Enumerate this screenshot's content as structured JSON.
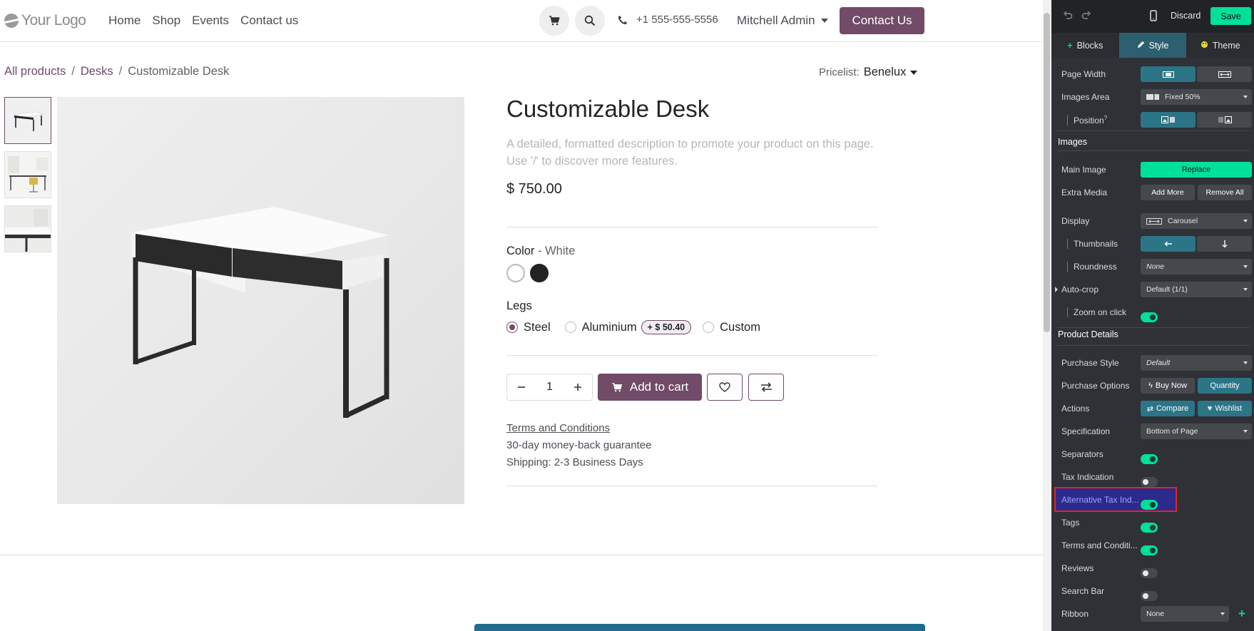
{
  "site": {
    "logo_text": "Your Logo",
    "menu": [
      "Home",
      "Shop",
      "Events",
      "Contact us"
    ],
    "phone": "+1 555-555-5556",
    "user": "Mitchell Admin",
    "contact_button": "Contact Us",
    "breadcrumb": [
      "All products",
      "Desks",
      "Customizable Desk"
    ],
    "breadcrumb_sep": "/",
    "pricelist_label": "Pricelist:",
    "pricelist_value": "Benelux",
    "product": {
      "title": "Customizable Desk",
      "description": "A detailed, formatted description to promote your product on this page. Use '/' to discover more features.",
      "price": "$ 750.00",
      "color_label": "Color",
      "color_sep": " - ",
      "color_value": "White",
      "color_swatches": [
        "#ffffff",
        "#222222"
      ],
      "legs_label": "Legs",
      "legs_options": [
        {
          "label": "Steel",
          "checked": true
        },
        {
          "label": "Aluminium",
          "extra": "+ $ 50.40"
        },
        {
          "label": "Custom"
        }
      ],
      "quantity": "1",
      "add_to_cart": "Add to cart",
      "terms_link": "Terms and Conditions",
      "guarantee": "30-day money-back guarantee",
      "shipping": "Shipping: 2-3 Business Days"
    }
  },
  "editor": {
    "discard": "Discard",
    "save": "Save",
    "tabs": [
      "Blocks",
      "Style",
      "Theme"
    ],
    "rows": {
      "page_width": "Page Width",
      "images_area": "Images Area",
      "images_area_value": "Fixed 50%",
      "position": "Position",
      "images_section": "Images",
      "main_image": "Main Image",
      "replace": "Replace",
      "extra_media": "Extra Media",
      "add_more": "Add More",
      "remove_all": "Remove All",
      "display": "Display",
      "display_value": "Carousel",
      "thumbnails": "Thumbnails",
      "roundness": "Roundness",
      "roundness_value": "None",
      "auto_crop": "Auto-crop",
      "auto_crop_value": "Default (1/1)",
      "zoom_on_click": "Zoom on click",
      "product_details_section": "Product Details",
      "purchase_style": "Purchase Style",
      "purchase_style_value": "Default",
      "purchase_options": "Purchase Options",
      "buy_now": "Buy Now",
      "quantity": "Quantity",
      "actions": "Actions",
      "compare": "Compare",
      "wishlist": "Wishlist",
      "specification": "Specification",
      "specification_value": "Bottom of Page",
      "separators": "Separators",
      "tax_indication": "Tax Indication",
      "alt_tax_indication": "Alternative Tax Ind...",
      "tags": "Tags",
      "terms_and_conditions": "Terms and Conditi...",
      "reviews": "Reviews",
      "search_bar": "Search Bar",
      "ribbon": "Ribbon",
      "ribbon_value": "None"
    },
    "toggles": {
      "zoom_on_click": true,
      "separators": true,
      "tax_indication": false,
      "alt_tax_indication": true,
      "tags": true,
      "terms_and_conditions": true,
      "reviews": false,
      "search_bar": false
    }
  },
  "colors": {
    "brand": "#714b67",
    "editor_bg": "#2f3136",
    "editor_accent": "#00e09a",
    "editor_active": "#2b7586",
    "highlight_border": "#e02424"
  }
}
